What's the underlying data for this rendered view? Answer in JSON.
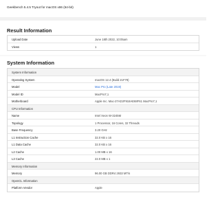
{
  "header": {
    "title": "Geekbench 5.4.5 Tryout for macOS x86 (64-bit)"
  },
  "result_information": {
    "title": "Result Information",
    "rows": [
      {
        "key": "Upload Date",
        "value": "June 18th 2022, 10:05am"
      },
      {
        "key": "Views",
        "value": "1"
      }
    ]
  },
  "system_information": {
    "title": "System Information",
    "rows": [
      {
        "key": "System Information",
        "value": "",
        "group": true
      },
      {
        "key": "Operating System",
        "value": "macOS 12.4 (Build 21F79)"
      },
      {
        "key": "Model",
        "value": "Mac Pro (Late 2019)",
        "link": true
      },
      {
        "key": "Model ID",
        "value": "MacPro7,1"
      },
      {
        "key": "Motherboard",
        "value": "Apple Inc. Mac-27AD2F918AE68F61 MacPro7,1"
      },
      {
        "key": "CPU Information",
        "value": "",
        "group": true
      },
      {
        "key": "Name",
        "value": "Intel Xeon W-3245M"
      },
      {
        "key": "Topology",
        "value": "1 Processor, 16 Cores, 32 Threads"
      },
      {
        "key": "Base Frequency",
        "value": "3.20 GHz"
      },
      {
        "key": "L1 Instruction Cache",
        "value": "32.0 KB x 16"
      },
      {
        "key": "L1 Data Cache",
        "value": "32.0 KB x 16"
      },
      {
        "key": "L2 Cache",
        "value": "1.00 MB x 16"
      },
      {
        "key": "L3 Cache",
        "value": "22.0 MB x 1"
      },
      {
        "key": "Memory Information",
        "value": "",
        "group": true
      },
      {
        "key": "Memory",
        "value": "96.00 GB DDR4 2933 MT/s"
      },
      {
        "key": "OpenCL Information",
        "value": "",
        "group": true
      },
      {
        "key": "Platform Vendor",
        "value": "Apple"
      }
    ]
  }
}
